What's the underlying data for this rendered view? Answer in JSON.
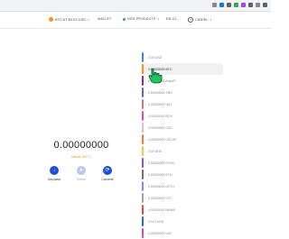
{
  "topnav": {
    "network_label": "BTC AT $0.02 USD",
    "wallet_label": "WALLET",
    "products_label": "HGS PRODUCTS",
    "language_label": "EN-GL",
    "account_label": "CAMIEL"
  },
  "balance": {
    "amount": "0.00000000",
    "unit": "Bitcoin (BTC)"
  },
  "actions": {
    "deposit_label": "Depositar",
    "send_label": "Retirar",
    "convert_label": "Convertir"
  },
  "coins": [
    {
      "label": "0.00 USD",
      "color": "#3b82f6"
    },
    {
      "label": "0.00000000 BTC",
      "color": "#f7931a"
    },
    {
      "label": "0.00000000 AudioP",
      "color": "#8e24aa"
    },
    {
      "label": "0.00000000 XRD",
      "color": "#5c6bc0"
    },
    {
      "label": "0.00000000 NAT",
      "color": "#e57373"
    },
    {
      "label": "0.00000000 BCH",
      "color": "#ec4899"
    },
    {
      "label": "0.00000000 CAZ",
      "color": "#f0b3c8"
    },
    {
      "label": "0.00000000 CELOP",
      "color": "#ff7043"
    },
    {
      "label": "0.00 DHS",
      "color": "#f4c542"
    },
    {
      "label": "0.00000000 DYNX",
      "color": "#7e57c2"
    },
    {
      "label": "0.00000000 ETH",
      "color": "#6b7280"
    },
    {
      "label": "0.00000000 LEYO",
      "color": "#818cf8"
    },
    {
      "label": "0.00000000 LTC",
      "color": "#a1a1aa"
    },
    {
      "label": "0.00000000 MANA",
      "color": "#ef4444"
    },
    {
      "label": "0.00 TUSD",
      "color": "#2563eb"
    },
    {
      "label": "0.00000000 UNI",
      "color": "#ec4899"
    }
  ],
  "colors": {
    "accent": "#1d4ed8",
    "bitcoin": "#f7931a"
  },
  "icons": {
    "deposit": "arrow-down-icon",
    "send": "send-icon",
    "convert": "convert-icon",
    "account": "user-icon",
    "bitcoin": "bitcoin-icon"
  }
}
